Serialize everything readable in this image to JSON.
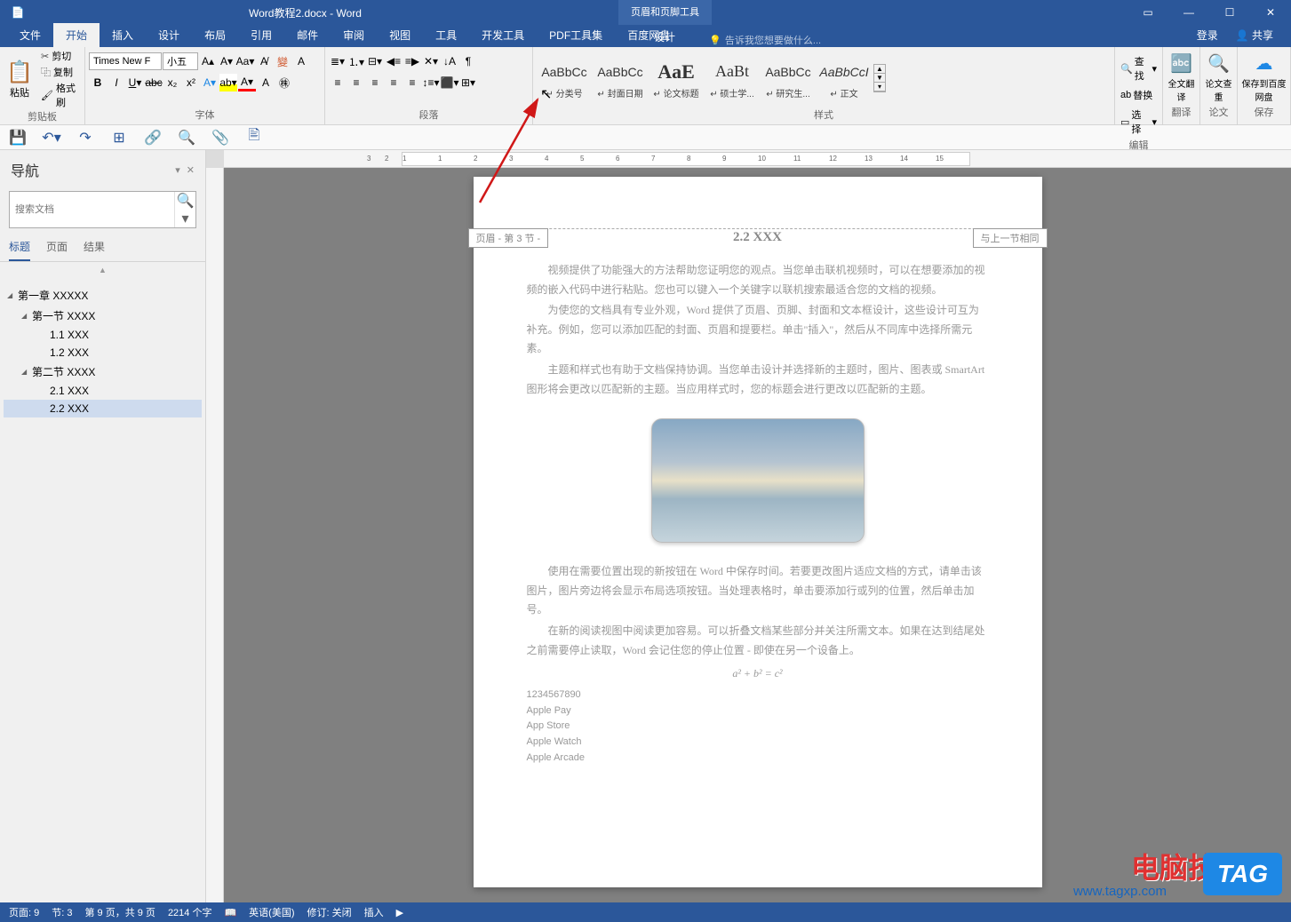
{
  "title_bar": {
    "doc_title": "Word教程2.docx - Word",
    "context_tool": "页眉和页脚工具"
  },
  "menu": {
    "file": "文件",
    "home": "开始",
    "insert": "插入",
    "design": "设计",
    "layout": "布局",
    "references": "引用",
    "mail": "邮件",
    "review": "审阅",
    "view": "视图",
    "tools": "工具",
    "dev": "开发工具",
    "pdf": "PDF工具集",
    "baidu": "百度网盘",
    "context_design": "设计",
    "tell_me": "告诉我您想要做什么...",
    "login": "登录",
    "share": "共享"
  },
  "ribbon": {
    "clipboard": {
      "label": "剪贴板",
      "paste": "粘贴",
      "cut": "剪切",
      "copy": "复制",
      "format_painter": "格式刷"
    },
    "font": {
      "label": "字体",
      "name": "Times New F",
      "size": "小五"
    },
    "paragraph": {
      "label": "段落"
    },
    "styles": {
      "label": "样式",
      "items": [
        {
          "preview": "AaBbCc",
          "name": "↵ 分类号",
          "cls": ""
        },
        {
          "preview": "AaBbCc",
          "name": "↵ 封面日期",
          "cls": ""
        },
        {
          "preview": "AaE",
          "name": "↵ 论文标题",
          "cls": "large"
        },
        {
          "preview": "AaBt",
          "name": "↵ 硕士学...",
          "cls": "med"
        },
        {
          "preview": "AaBbCc",
          "name": "↵ 研究生...",
          "cls": ""
        },
        {
          "preview": "AaBbCcI",
          "name": "↵ 正文",
          "cls": "italic"
        }
      ]
    },
    "edit": {
      "label": "编辑",
      "find": "查找",
      "replace": "替换",
      "select": "选择"
    },
    "translate": {
      "label": "翻译",
      "full": "全文翻译"
    },
    "review": {
      "label": "论文",
      "check": "论文查重"
    },
    "save": {
      "label": "保存",
      "baidu": "保存到百度网盘"
    }
  },
  "nav": {
    "title": "导航",
    "search_placeholder": "搜索文档",
    "tabs": {
      "headings": "标题",
      "pages": "页面",
      "results": "结果"
    },
    "tree": [
      {
        "level": 0,
        "text": "第一章 XXXXX",
        "expand": true
      },
      {
        "level": 1,
        "text": "第一节 XXXX",
        "expand": true
      },
      {
        "level": 2,
        "text": "1.1 XXX"
      },
      {
        "level": 2,
        "text": "1.2 XXX"
      },
      {
        "level": 1,
        "text": "第二节 XXXX",
        "expand": true
      },
      {
        "level": 2,
        "text": "2.1 XXX"
      },
      {
        "level": 2,
        "text": "2.2 XXX",
        "selected": true
      }
    ]
  },
  "document": {
    "header_left": "页眉 - 第 3 节 -",
    "header_right": "与上一节相同",
    "title": "2.2 XXX",
    "p1": "视频提供了功能强大的方法帮助您证明您的观点。当您单击联机视频时，可以在想要添加的视频的嵌入代码中进行粘贴。您也可以键入一个关键字以联机搜索最适合您的文档的视频。",
    "p2": "为使您的文档具有专业外观，Word 提供了页眉、页脚、封面和文本框设计，这些设计可互为补充。例如，您可以添加匹配的封面、页眉和提要栏。单击\"插入\"，然后从不同库中选择所需元素。",
    "p3": "主题和样式也有助于文档保持协调。当您单击设计并选择新的主题时，图片、图表或 SmartArt 图形将会更改以匹配新的主题。当应用样式时，您的标题会进行更改以匹配新的主题。",
    "p4": "使用在需要位置出现的新按钮在 Word 中保存时间。若要更改图片适应文档的方式，请单击该图片，图片旁边将会显示布局选项按钮。当处理表格时，单击要添加行或列的位置，然后单击加号。",
    "p5": "在新的阅读视图中阅读更加容易。可以折叠文档某些部分并关注所需文本。如果在达到结尾处之前需要停止读取，Word 会记住您的停止位置 - 即使在另一个设备上。",
    "formula": "a² + b² = c²",
    "lines": [
      "1234567890",
      "Apple Pay",
      "App Store",
      "Apple Watch",
      "Apple Arcade"
    ]
  },
  "status": {
    "page": "页面: 9",
    "section": "节: 3",
    "page_of": "第 9 页，共 9 页",
    "words": "2214 个字",
    "lang": "英语(美国)",
    "track": "修订: 关闭",
    "insert": "插入"
  },
  "watermark": {
    "brand": "电脑技术网",
    "url": "www.tagxp.com",
    "tag": "TAG"
  }
}
